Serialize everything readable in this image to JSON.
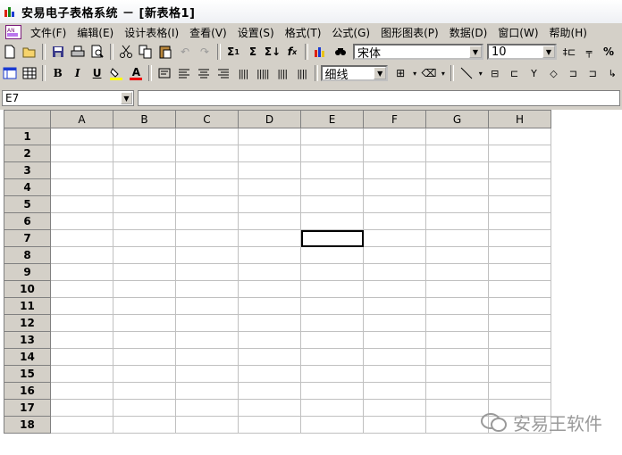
{
  "window": {
    "title": "安易电子表格系统 － [新表格1]"
  },
  "menu": [
    "文件(F)",
    "编辑(E)",
    "设计表格(I)",
    "查看(V)",
    "设置(S)",
    "格式(T)",
    "公式(G)",
    "图形图表(P)",
    "数据(D)",
    "窗口(W)",
    "帮助(H)"
  ],
  "toolbar1": {
    "font_name": "宋体",
    "font_size": "10",
    "buttons": [
      "new-file",
      "open-folder",
      "save",
      "print",
      "print-preview",
      "cut",
      "copy",
      "paste",
      "undo",
      "redo",
      "sum",
      "sum-alt",
      "sort",
      "function",
      "chart",
      "find"
    ]
  },
  "toolbar2": {
    "line_style": "细线",
    "bold": "B",
    "italic": "I",
    "underline": "U",
    "font_color_glyph": "A"
  },
  "formula_bar": {
    "cell_ref": "E7",
    "content": ""
  },
  "sheet": {
    "columns": [
      "A",
      "B",
      "C",
      "D",
      "E",
      "F",
      "G",
      "H"
    ],
    "rows": [
      "1",
      "2",
      "3",
      "4",
      "5",
      "6",
      "7",
      "8",
      "9",
      "10",
      "11",
      "12",
      "13",
      "14",
      "15",
      "16",
      "17",
      "18"
    ],
    "active_cell": "E7"
  },
  "watermark": {
    "text": "安易王软件"
  },
  "colors": {
    "face": "#d4d0c8",
    "grid": "#c0c0c0",
    "active_border": "#000000"
  }
}
